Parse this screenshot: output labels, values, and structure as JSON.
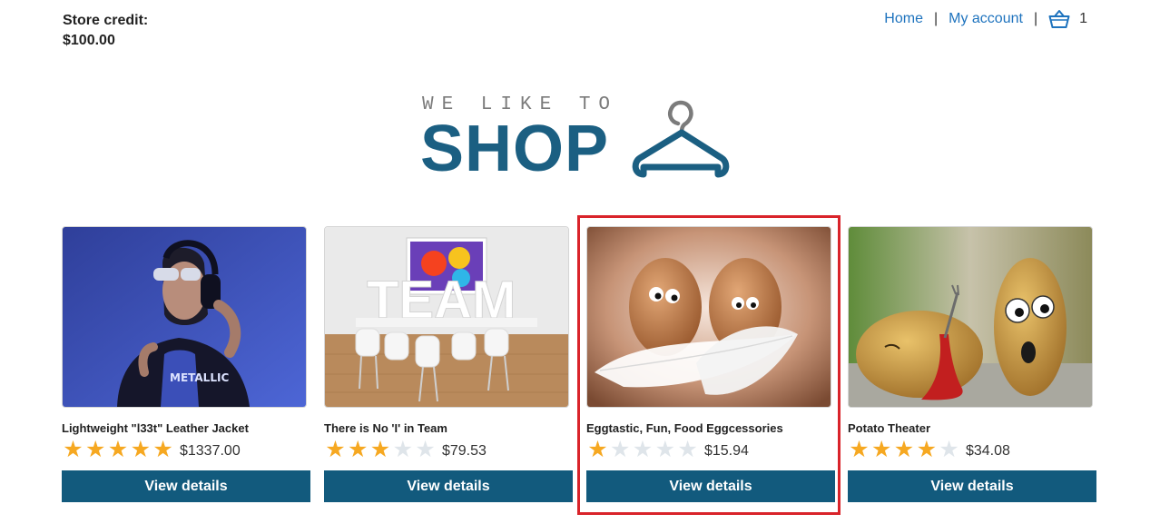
{
  "store_credit": {
    "label": "Store credit:",
    "amount": "$100.00"
  },
  "nav": {
    "home": "Home",
    "separator": "|",
    "my_account": "My account",
    "cart_icon": "basket-icon",
    "cart_count": "1"
  },
  "logo": {
    "tagline": "WE LIKE TO",
    "word": "SHOP",
    "icon": "hanger-icon"
  },
  "colors": {
    "accent": "#125a7d",
    "link": "#1e73be",
    "star_filled": "#f6a821",
    "star_empty": "#dfe5ea",
    "highlight": "#d9232a"
  },
  "products": [
    {
      "name": "Lightweight \"l33t\" Leather Jacket",
      "rating": 5,
      "rating_max": 5,
      "price": "$1337.00",
      "button": "View details",
      "image": "person-with-headphones-photo"
    },
    {
      "name": "There is No 'I' in Team",
      "rating": 3,
      "rating_max": 5,
      "price": "$79.53",
      "button": "View details",
      "image": "team-letters-meeting-room-photo"
    },
    {
      "name": "Eggtastic, Fun, Food Eggcessories",
      "rating": 1,
      "rating_max": 5,
      "price": "$15.94",
      "button": "View details",
      "image": "eggs-with-googly-eyes-photo"
    },
    {
      "name": "Potato Theater",
      "rating": 4,
      "rating_max": 5,
      "price": "$34.08",
      "button": "View details",
      "image": "potatoes-with-googly-eyes-photo"
    }
  ]
}
